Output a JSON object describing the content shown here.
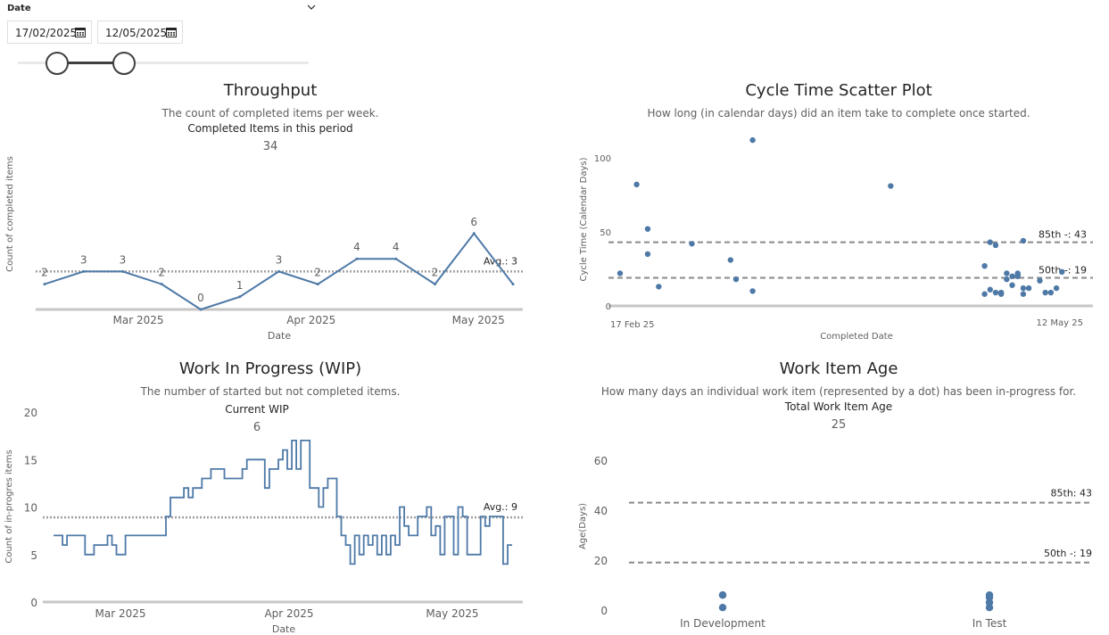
{
  "slicer": {
    "title": "Date",
    "start_date": "17/02/2025",
    "end_date": "12/05/2025"
  },
  "colors": {
    "line": "#4e79a7",
    "avg": "#a0a0a0",
    "axis": "#c8c6c4",
    "text": "#605e5c"
  },
  "throughput": {
    "title": "Throughput",
    "subtitle": "The count of completed items per week.",
    "kpi_label": "Completed Items in this period",
    "kpi_value": "34"
  },
  "cycle_time": {
    "title": "Cycle Time Scatter Plot",
    "subtitle": "How long (in calendar days) did an item take to complete once started."
  },
  "wip": {
    "title": "Work In Progress (WIP)",
    "subtitle": "The number of started but not completed items.",
    "kpi_label": "Current WIP",
    "kpi_value": "6"
  },
  "age": {
    "title": "Work Item Age",
    "subtitle": "How many days an individual work item (represented by a dot) has been in-progress for.",
    "kpi_label": "Total Work Item Age",
    "kpi_value": "25"
  },
  "chart_data": [
    {
      "type": "line",
      "id": "throughput",
      "xlabel": "Date",
      "ylabel": "Count of completed items",
      "x_tick_labels": [
        "Mar 2025",
        "Apr 2025",
        "May 2025"
      ],
      "x": [
        "2025-02-17",
        "2025-02-24",
        "2025-03-03",
        "2025-03-10",
        "2025-03-17",
        "2025-03-24",
        "2025-03-31",
        "2025-04-07",
        "2025-04-14",
        "2025-04-21",
        "2025-04-28",
        "2025-05-05",
        "2025-05-12"
      ],
      "values": [
        2,
        3,
        3,
        2,
        0,
        1,
        3,
        2,
        4,
        4,
        2,
        6,
        2
      ],
      "data_labels": [
        "2",
        "3",
        "3",
        "2",
        "0",
        "1",
        "3",
        "2",
        "4",
        "4",
        "2",
        "6",
        ""
      ],
      "avg": 3,
      "avg_label": "Avg.: 3",
      "ylim": [
        0,
        12
      ]
    },
    {
      "type": "scatter",
      "id": "cycle_time",
      "xlabel": "Completed Date",
      "ylabel": "Cycle Time (Calendar Days)",
      "x_tick_labels": [
        "17 Feb 25",
        "12 May 25"
      ],
      "y_ticks": [
        "0",
        "50",
        "100"
      ],
      "ylim": [
        0,
        110
      ],
      "percentiles": [
        {
          "value": 43,
          "label": "85th -: 43"
        },
        {
          "value": 19,
          "label": "50th -: 19"
        }
      ],
      "points": [
        {
          "x": "2025-02-17",
          "y": 22
        },
        {
          "x": "2025-02-20",
          "y": 82
        },
        {
          "x": "2025-02-22",
          "y": 52
        },
        {
          "x": "2025-02-22",
          "y": 35
        },
        {
          "x": "2025-02-24",
          "y": 13
        },
        {
          "x": "2025-03-02",
          "y": 42
        },
        {
          "x": "2025-03-09",
          "y": 31
        },
        {
          "x": "2025-03-10",
          "y": 18
        },
        {
          "x": "2025-03-13",
          "y": 10
        },
        {
          "x": "2025-03-13",
          "y": 112
        },
        {
          "x": "2025-04-07",
          "y": 81
        },
        {
          "x": "2025-04-24",
          "y": 27
        },
        {
          "x": "2025-04-24",
          "y": 8
        },
        {
          "x": "2025-04-25",
          "y": 11
        },
        {
          "x": "2025-04-25",
          "y": 43
        },
        {
          "x": "2025-04-26",
          "y": 9
        },
        {
          "x": "2025-04-26",
          "y": 41
        },
        {
          "x": "2025-04-27",
          "y": 8
        },
        {
          "x": "2025-04-27",
          "y": 9
        },
        {
          "x": "2025-04-28",
          "y": 18
        },
        {
          "x": "2025-04-28",
          "y": 22
        },
        {
          "x": "2025-04-29",
          "y": 14
        },
        {
          "x": "2025-04-29",
          "y": 20
        },
        {
          "x": "2025-04-30",
          "y": 21
        },
        {
          "x": "2025-04-30",
          "y": 20
        },
        {
          "x": "2025-04-30",
          "y": 22
        },
        {
          "x": "2025-05-01",
          "y": 12
        },
        {
          "x": "2025-05-01",
          "y": 44
        },
        {
          "x": "2025-05-01",
          "y": 8
        },
        {
          "x": "2025-05-02",
          "y": 12
        },
        {
          "x": "2025-05-04",
          "y": 17
        },
        {
          "x": "2025-05-05",
          "y": 9
        },
        {
          "x": "2025-05-06",
          "y": 9
        },
        {
          "x": "2025-05-07",
          "y": 12
        },
        {
          "x": "2025-05-08",
          "y": 23
        }
      ]
    },
    {
      "type": "line",
      "id": "wip",
      "xlabel": "Date",
      "ylabel": "Count of in-progres items",
      "x_tick_labels": [
        "Mar 2025",
        "Apr 2025",
        "May 2025"
      ],
      "y_ticks": [
        "0",
        "5",
        "10",
        "15",
        "20"
      ],
      "ylim": [
        0,
        20
      ],
      "avg": 9,
      "avg_label": "Avg.: 9",
      "values": [
        7,
        7,
        6,
        7,
        7,
        7,
        7,
        5,
        5,
        6,
        6,
        6,
        7,
        6,
        5,
        5,
        7,
        7,
        7,
        7,
        7,
        7,
        7,
        7,
        7,
        9,
        11,
        11,
        11,
        12,
        11,
        12,
        12,
        13,
        13,
        14,
        14,
        14,
        13,
        13,
        13,
        13,
        14,
        15,
        15,
        15,
        15,
        12,
        14,
        14,
        15,
        16,
        14,
        17,
        14,
        17,
        17,
        12,
        12,
        10,
        12,
        13,
        13,
        9,
        7,
        6,
        4,
        7,
        5,
        7,
        6,
        7,
        5,
        7,
        5,
        7,
        6,
        10,
        8,
        7,
        7,
        9,
        9,
        10,
        7,
        8,
        5,
        9,
        9,
        5,
        10,
        9,
        5,
        5,
        5,
        9,
        8,
        9,
        9,
        9,
        4,
        6
      ]
    },
    {
      "type": "scatter",
      "id": "age",
      "xlabel": "",
      "ylabel": "Age(Days)",
      "categories": [
        "In Development",
        "In Test"
      ],
      "y_ticks": [
        "0",
        "20",
        "40",
        "60"
      ],
      "ylim": [
        0,
        60
      ],
      "percentiles": [
        {
          "value": 43,
          "label": "85th: 43"
        },
        {
          "value": 19,
          "label": "50th -: 19"
        }
      ],
      "points": [
        {
          "category": "In Development",
          "y": 6
        },
        {
          "category": "In Development",
          "y": 6
        },
        {
          "category": "In Development",
          "y": 1
        },
        {
          "category": "In Test",
          "y": 6
        },
        {
          "category": "In Test",
          "y": 5
        },
        {
          "category": "In Test",
          "y": 3
        },
        {
          "category": "In Test",
          "y": 1
        }
      ]
    }
  ]
}
